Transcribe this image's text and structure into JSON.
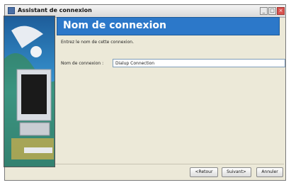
{
  "window": {
    "title": "Assistant de connexion"
  },
  "header": {
    "title": "Nom de connexion"
  },
  "subtitle": "Entrez le nom de cette connexion.",
  "form": {
    "name_label": "Nom de connexion :",
    "name_value": "Dialup Connection"
  },
  "buttons": {
    "back": "<Retour",
    "next": "Suivant>",
    "cancel": "Annuler"
  },
  "colors": {
    "header": "#2c78c9",
    "panel": "#2a7ab5"
  },
  "icons": {
    "app": "modem-icon",
    "minimize": "minimize-icon",
    "maximize": "maximize-icon",
    "close": "close-icon"
  }
}
